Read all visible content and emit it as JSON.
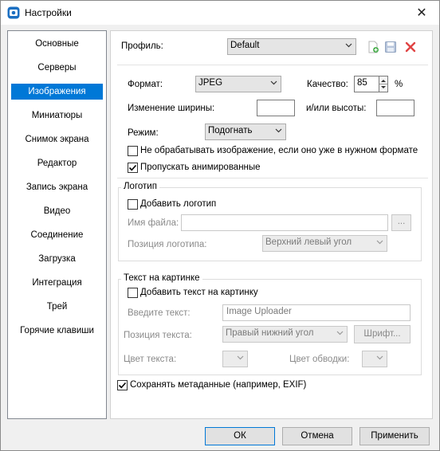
{
  "window": {
    "title": "Настройки",
    "close_glyph": "✕"
  },
  "sidebar": {
    "items": [
      {
        "label": "Основные"
      },
      {
        "label": "Серверы"
      },
      {
        "label": "Изображения",
        "selected": true
      },
      {
        "label": "Миниатюры"
      },
      {
        "label": "Снимок экрана"
      },
      {
        "label": "Редактор"
      },
      {
        "label": "Запись экрана"
      },
      {
        "label": "Видео"
      },
      {
        "label": "Соединение"
      },
      {
        "label": "Загрузка"
      },
      {
        "label": "Интеграция"
      },
      {
        "label": "Трей"
      },
      {
        "label": "Горячие клавиши"
      }
    ]
  },
  "profile": {
    "label": "Профиль:",
    "value": "Default",
    "icons": [
      "add-profile-icon",
      "save-profile-icon",
      "delete-profile-icon"
    ]
  },
  "image": {
    "format_label": "Формат:",
    "format_value": "JPEG",
    "quality_label": "Качество:",
    "quality_value": "85",
    "quality_unit": "%",
    "width_label": "Изменение ширины:",
    "width_value": "",
    "height_label": "и/или высоты:",
    "height_value": "",
    "mode_label": "Режим:",
    "mode_value": "Подогнать",
    "skip_processing_label": "Не обрабатывать изображение, если оно уже в нужном формате",
    "skip_processing_checked": false,
    "skip_animated_label": "Пропускать анимированные",
    "skip_animated_checked": true
  },
  "logo": {
    "group_title": "Логотип",
    "add_logo_label": "Добавить логотип",
    "add_logo_checked": false,
    "filename_label": "Имя файла:",
    "filename_value": "",
    "browse_label": "...",
    "position_label": "Позиция логотипа:",
    "position_value": "Верхний левый угол"
  },
  "text_overlay": {
    "group_title": "Текст на картинке",
    "add_text_label": "Добавить текст на картинку",
    "add_text_checked": false,
    "enter_text_label": "Введите текст:",
    "enter_text_value": "Image Uploader",
    "position_label": "Позиция текста:",
    "position_value": "Правый нижний угол",
    "font_button_label": "Шрифт...",
    "text_color_label": "Цвет текста:",
    "stroke_color_label": "Цвет обводки:"
  },
  "metadata": {
    "label": "Сохранять метаданные (например, EXIF)",
    "checked": true
  },
  "footer": {
    "ok_label": "ОК",
    "cancel_label": "Отмена",
    "apply_label": "Применить"
  },
  "colors": {
    "accent": "#0078d7",
    "delete_red": "#e04343"
  }
}
